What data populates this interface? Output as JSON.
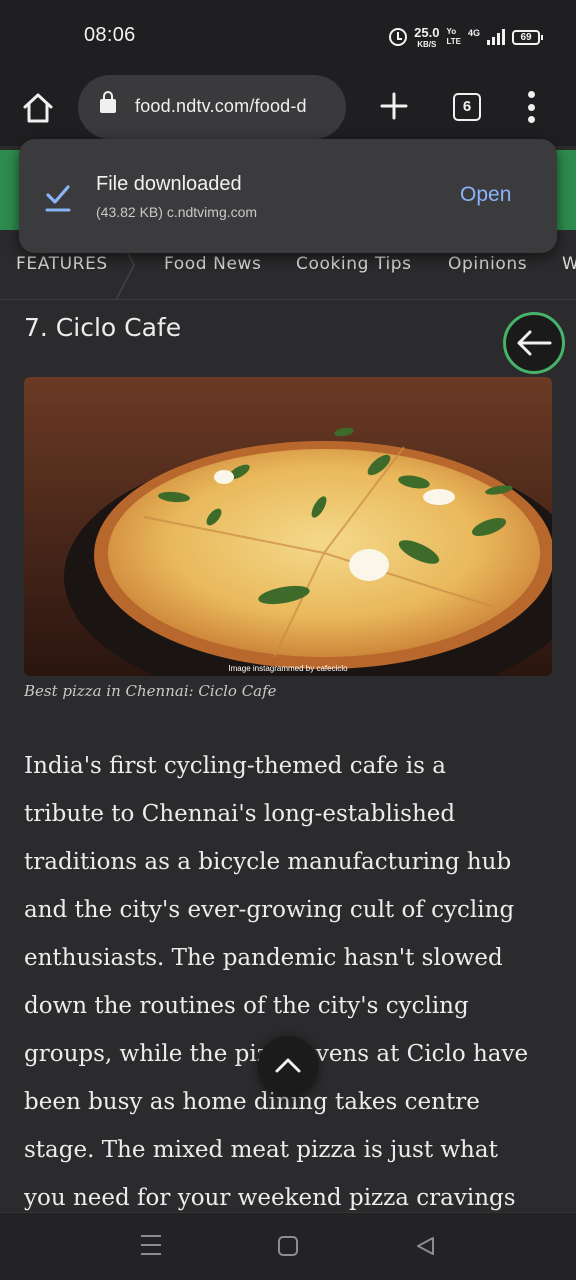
{
  "status": {
    "time": "08:06",
    "net_speed": "25.0",
    "net_speed_unit": "KB/S",
    "volte": "Yo",
    "volte_sub": "LTE",
    "network": "4G",
    "battery": "69"
  },
  "browser": {
    "url": "food.ndtv.com/food-d",
    "tab_count": "6"
  },
  "toast": {
    "title": "File downloaded",
    "subtitle": "(43.82 KB) c.ndtvimg.com",
    "action": "Open"
  },
  "page_nav": {
    "items": [
      "FEATURES",
      "Food News",
      "Cooking Tips",
      "Opinions",
      "W"
    ]
  },
  "article": {
    "heading": "7. Ciclo Cafe",
    "image_credit": "Image instagrammed by cafeciclo",
    "caption": "Best pizza in Chennai: Ciclo Cafe",
    "lines": [
      "India's first cycling-themed cafe is a",
      "tribute to Chennai's long-established",
      "traditions as a bicycle manufacturing hub",
      "and the city's ever-growing cult of cycling",
      "enthusiasts. The pandemic hasn't slowed",
      "down the routines of the city's cycling",
      "groups, while the pizza ovens at Ciclo have",
      "been busy as home dining takes centre",
      "stage. The mixed meat pizza is just what",
      "you need for your weekend pizza cravings"
    ]
  },
  "colors": {
    "accent_green": "#2d8c4d",
    "link_blue": "#8ab4f8",
    "fab_ring": "#47b36a"
  }
}
